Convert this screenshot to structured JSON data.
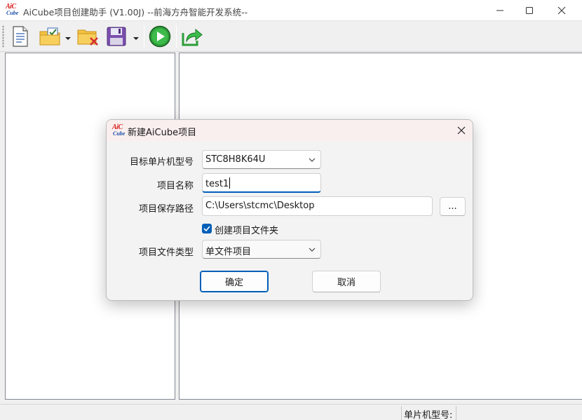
{
  "window": {
    "title": "AiCube项目创建助手 (V1.00J) --前海方舟智能开发系统--",
    "logo_top": "AiC",
    "logo_bottom": "Cube"
  },
  "toolbar": {
    "items": [
      {
        "name": "new-file",
        "icon": "document-icon"
      },
      {
        "name": "open-project",
        "icon": "folder-check-icon",
        "has_dropdown": true
      },
      {
        "name": "close-project",
        "icon": "folder-delete-icon"
      },
      {
        "name": "save",
        "icon": "floppy-disk-icon",
        "has_dropdown": true
      },
      {
        "name": "run",
        "icon": "play-icon"
      },
      {
        "name": "export",
        "icon": "share-arrow-icon"
      }
    ]
  },
  "statusbar": {
    "mcu_label": "单片机型号:"
  },
  "dialog": {
    "title": "新建AiCube项目",
    "mcu_label": "目标单片机型号",
    "mcu_value": "STC8H8K64U",
    "name_label": "项目名称",
    "name_value": "test1",
    "path_label": "项目保存路径",
    "path_value": "C:\\Users\\stcmc\\Desktop",
    "browse_label": "...",
    "create_folder_label": "创建项目文件夹",
    "create_folder_checked": true,
    "type_label": "项目文件类型",
    "type_value": "单文件项目",
    "ok_label": "确定",
    "cancel_label": "取消"
  },
  "colors": {
    "accent": "#005fb8",
    "dialog_title_bg": "#f9efee",
    "logo_red": "#d81e1e",
    "logo_blue": "#1f4fa8"
  }
}
